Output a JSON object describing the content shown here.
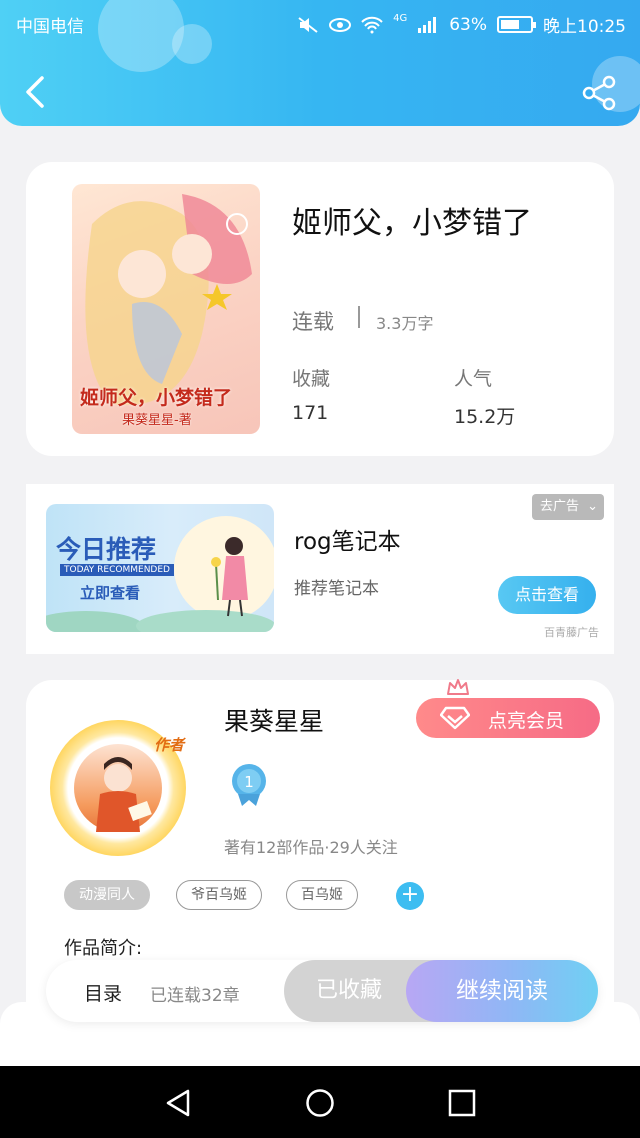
{
  "status_bar": {
    "carrier": "中国电信",
    "network": "4G",
    "battery_percent": "63%",
    "battery_level": 0.63,
    "time": "晚上10:25"
  },
  "header": {
    "back_icon": "chevron-left-icon",
    "share_icon": "share-icon",
    "background_color": "#36b6f2"
  },
  "book": {
    "title": "姬师父，小梦错了",
    "cover_title": "姬师父，小梦错了",
    "cover_author": "果葵星星-著",
    "status": "连载",
    "word_count": "3.3万字",
    "stats": [
      {
        "label": "收藏",
        "value": "171"
      },
      {
        "label": "人气",
        "value": "15.2万"
      }
    ]
  },
  "ad": {
    "image_title": "今日推荐",
    "image_subtitle": "TODAY RECOMMENDED",
    "image_cta": "立即查看",
    "title": "rog笔记本",
    "description": "推荐笔记本",
    "tag": "去广告",
    "button": "点击查看",
    "source": "百青藤广告"
  },
  "author": {
    "name": "果葵星星",
    "badge": "作者",
    "vip_button": "点亮会员",
    "level": "1",
    "works_info": "著有12部作品·29人关注",
    "tags": [
      "动漫同人",
      "爷百乌姬",
      "百乌姬"
    ],
    "add_tag": "+",
    "intro_label": "作品简介:"
  },
  "action_bar": {
    "toc_label": "目录",
    "toc_count": "已连载32章",
    "collected": "已收藏",
    "read": "继续阅读"
  },
  "colors": {
    "accent": "#35b0ee",
    "vip": "#f66b86",
    "read_gradient_start": "#b8a7f4",
    "read_gradient_end": "#6fd0f3"
  }
}
